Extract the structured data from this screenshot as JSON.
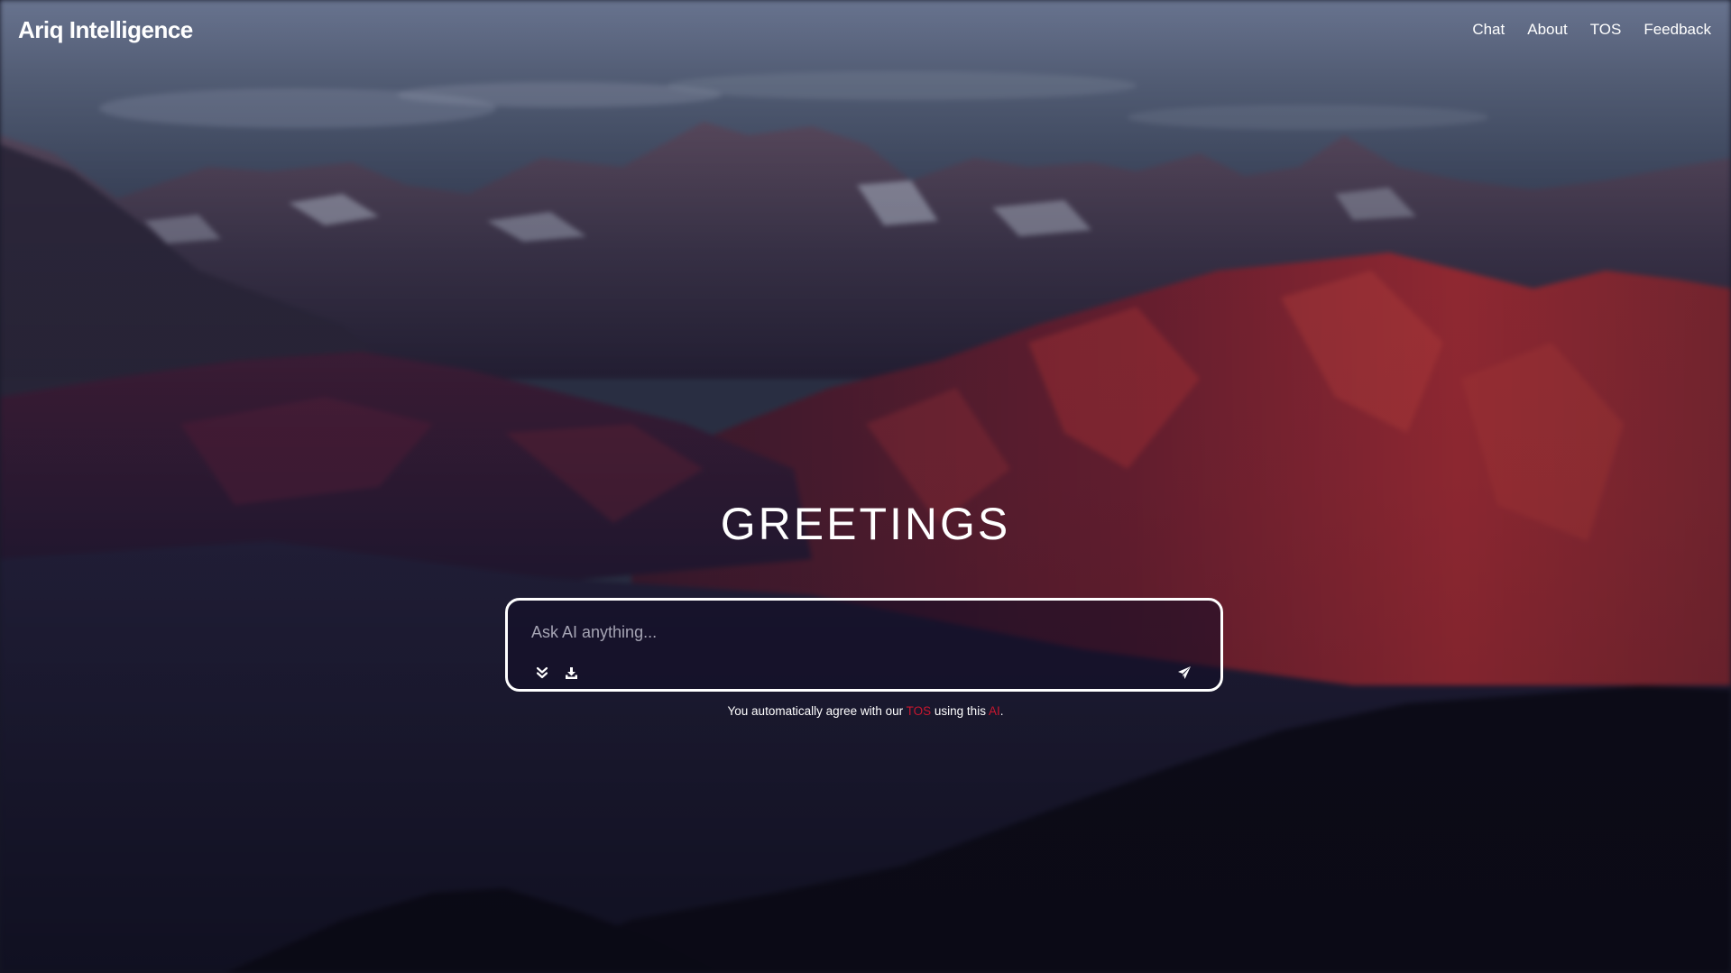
{
  "header": {
    "brand": "Ariq Intelligence",
    "nav": [
      {
        "label": "Chat"
      },
      {
        "label": "About"
      },
      {
        "label": "TOS"
      },
      {
        "label": "Feedback"
      }
    ]
  },
  "hero": {
    "title": "GREETINGS"
  },
  "chat": {
    "placeholder": "Ask AI anything...",
    "value": "",
    "icons": {
      "expand": "double-chevron-down-icon",
      "download": "download-icon",
      "send": "send-icon"
    }
  },
  "disclaimer": {
    "prefix": "You automatically agree with our ",
    "tos_link": "TOS",
    "middle": " using this ",
    "ai_link": "AI",
    "suffix": "."
  },
  "colors": {
    "accent": "#c8172f",
    "text": "#ffffff"
  }
}
